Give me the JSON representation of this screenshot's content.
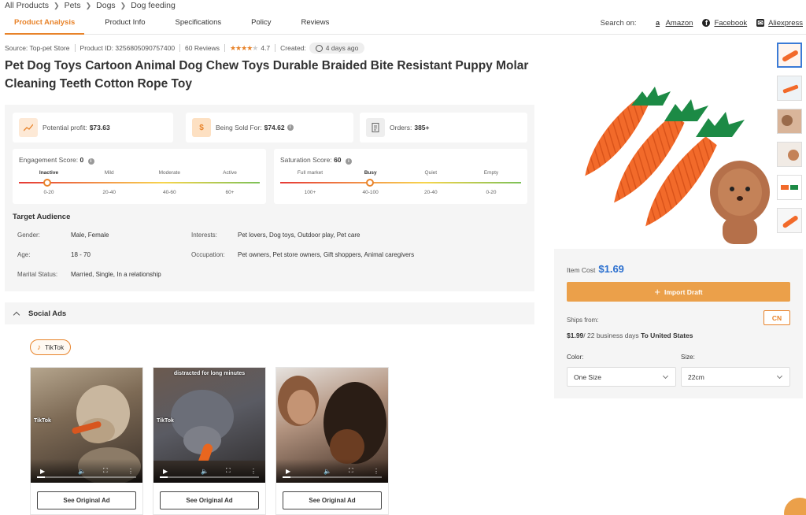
{
  "breadcrumb": [
    "All Products",
    "Pets",
    "Dogs",
    "Dog feeding"
  ],
  "tabs": [
    "Product Analysis",
    "Product Info",
    "Specifications",
    "Policy",
    "Reviews"
  ],
  "search_on": {
    "label": "Search on:",
    "sites": [
      {
        "name": "Amazon",
        "icon": "amazon-icon"
      },
      {
        "name": "Facebook",
        "icon": "facebook-icon"
      },
      {
        "name": "Aliexpress",
        "icon": "aliexpress-icon"
      }
    ]
  },
  "meta": {
    "source": "Source: Top-pet Store",
    "product_id": "Product ID: 3256805090757400",
    "reviews": "60 Reviews",
    "rating": "4.7",
    "rating_stars": 4.5,
    "created_label": "Created:",
    "created_value": "4 days ago"
  },
  "title": "Pet Dog Toys Cartoon Animal Dog Chew Toys Durable Braided Bite Resistant Puppy Molar Cleaning Teeth Cotton Rope Toy",
  "stats": {
    "profit_label": "Potential profit:",
    "profit_value": "$73.63",
    "sold_label": "Being Sold For:",
    "sold_value": "$74.62",
    "orders_label": "Orders:",
    "orders_value": "385+"
  },
  "engagement": {
    "label": "Engagement Score:",
    "value": "0",
    "levels": [
      "Inactive",
      "Mild",
      "Moderate",
      "Active"
    ],
    "ranges": [
      "0-20",
      "20-40",
      "40-60",
      "60+"
    ],
    "selected": "Inactive"
  },
  "saturation": {
    "label": "Saturation Score:",
    "value": "60",
    "levels": [
      "Full market",
      "Busy",
      "Quiet",
      "Empty"
    ],
    "ranges": [
      "100+",
      "40-100",
      "20-40",
      "0-20"
    ],
    "selected": "Busy"
  },
  "audience": {
    "title": "Target Audience",
    "gender_label": "Gender:",
    "gender": "Male, Female",
    "age_label": "Age:",
    "age": "18 - 70",
    "marital_label": "Marital Status:",
    "marital": "Married, Single, In a relationship",
    "interests_label": "Interests:",
    "interests": "Pet lovers, Dog toys, Outdoor play, Pet care",
    "occupation_label": "Occupation:",
    "occupation": "Pet owners, Pet store owners, Gift shoppers, Animal caregivers"
  },
  "social": {
    "title": "Social Ads",
    "platform": "TikTok",
    "ad_button": "See Original Ad",
    "ads": [
      {
        "caption": "",
        "tiktok": "TikTok"
      },
      {
        "caption": "distracted for long minutes",
        "tiktok": "TikTok"
      },
      {
        "caption": "",
        "tiktok": ""
      }
    ]
  },
  "purchase": {
    "item_cost_label": "Item Cost",
    "item_cost": "$1.69",
    "import_label": "Import Draft",
    "ships_from_label": "Ships from:",
    "origin": "CN",
    "ship_price": "$1.99",
    "ship_days": "/ 22 business days",
    "ship_to": "To United States",
    "color_label": "Color:",
    "color_value": "One Size",
    "size_label": "Size:",
    "size_value": "22cm"
  },
  "colors": {
    "accent": "#e8832a",
    "link_blue": "#2a6fcf",
    "panel": "#f5f5f5"
  }
}
